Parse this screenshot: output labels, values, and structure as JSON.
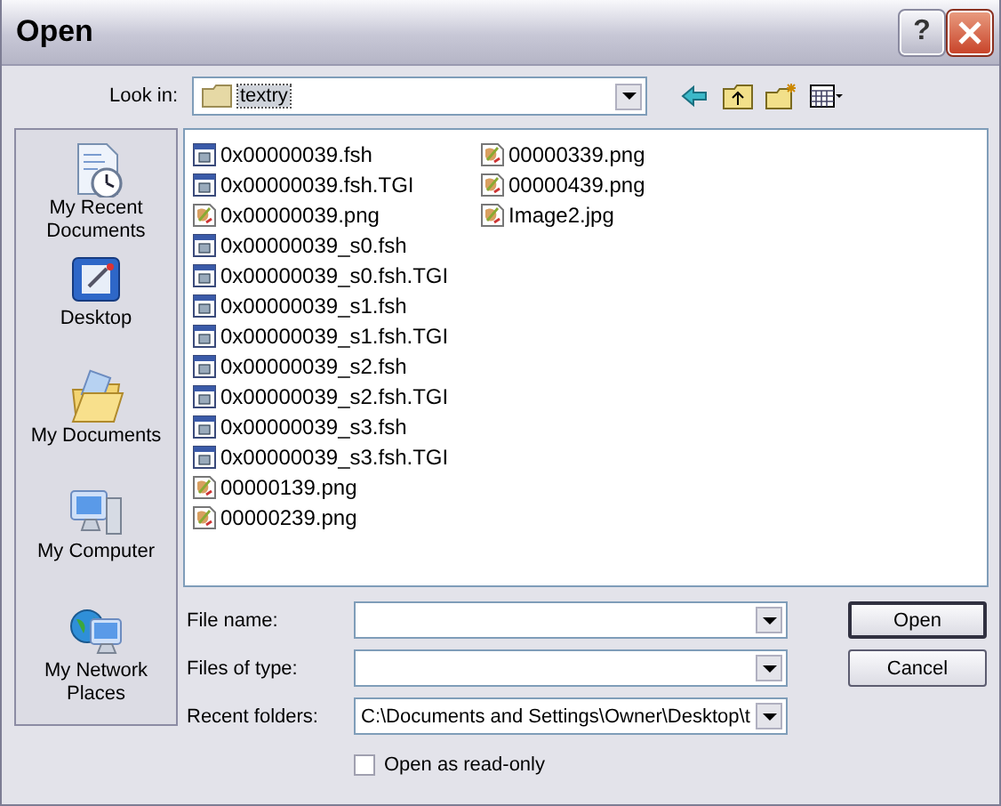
{
  "window": {
    "title": "Open"
  },
  "title_buttons": [
    {
      "kind": "help",
      "label": "?"
    },
    {
      "kind": "close"
    }
  ],
  "look_in": {
    "label": "Look in:",
    "value": "textry"
  },
  "toolbar": [
    {
      "kind": "back"
    },
    {
      "kind": "up"
    },
    {
      "kind": "new-folder"
    },
    {
      "kind": "views"
    }
  ],
  "places": [
    {
      "kind": "recent",
      "label": "My Recent Documents"
    },
    {
      "kind": "desktop",
      "label": "Desktop"
    },
    {
      "kind": "documents",
      "label": "My Documents"
    },
    {
      "kind": "computer",
      "label": "My Computer"
    },
    {
      "kind": "network",
      "label": "My Network Places"
    }
  ],
  "files": [
    {
      "kind": "fsh",
      "name": "0x00000039.fsh"
    },
    {
      "kind": "fsh",
      "name": "0x00000039.fsh.TGI"
    },
    {
      "kind": "image",
      "name": "0x00000039.png"
    },
    {
      "kind": "fsh",
      "name": "0x00000039_s0.fsh"
    },
    {
      "kind": "fsh",
      "name": "0x00000039_s0.fsh.TGI"
    },
    {
      "kind": "fsh",
      "name": "0x00000039_s1.fsh"
    },
    {
      "kind": "fsh",
      "name": "0x00000039_s1.fsh.TGI"
    },
    {
      "kind": "fsh",
      "name": "0x00000039_s2.fsh"
    },
    {
      "kind": "fsh",
      "name": "0x00000039_s2.fsh.TGI"
    },
    {
      "kind": "fsh",
      "name": "0x00000039_s3.fsh"
    },
    {
      "kind": "fsh",
      "name": "0x00000039_s3.fsh.TGI"
    },
    {
      "kind": "image",
      "name": "00000139.png"
    },
    {
      "kind": "image",
      "name": "00000239.png"
    },
    {
      "kind": "image",
      "name": "00000339.png"
    },
    {
      "kind": "image",
      "name": "00000439.png"
    },
    {
      "kind": "image",
      "name": "Image2.jpg"
    }
  ],
  "fields": [
    {
      "label": "File name:"
    },
    {
      "label": "Files of type:"
    },
    {
      "label": "Recent folders:",
      "value": "C:\\Documents and Settings\\Owner\\Desktop\\t"
    }
  ],
  "buttons": [
    {
      "label": "Open",
      "default": true
    },
    {
      "label": "Cancel",
      "default": false
    }
  ],
  "read_only": {
    "label": "Open as read-only",
    "checked": false
  }
}
